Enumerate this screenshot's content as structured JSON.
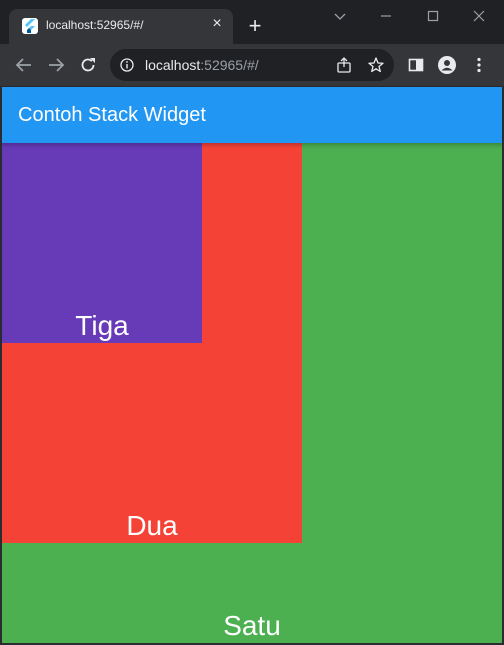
{
  "browser": {
    "tab": {
      "title": "localhost:52965/#/",
      "close_glyph": "×",
      "favicon": "flutter-logo-icon"
    },
    "new_tab_glyph": "+",
    "address": {
      "host": "localhost",
      "rest": ":52965/#/"
    },
    "icons": {
      "back": "back-arrow-icon",
      "forward": "forward-arrow-icon",
      "reload": "reload-icon",
      "info": "info-icon",
      "share": "share-icon",
      "star": "star-icon",
      "side_panel": "side-panel-icon",
      "profile": "profile-icon",
      "menu": "kebab-menu-icon",
      "tab_search": "chevron-down-icon",
      "minimize": "minimize-icon",
      "maximize": "maximize-icon",
      "close_window": "close-icon"
    }
  },
  "app": {
    "title": "Contoh Stack Widget",
    "colors": {
      "appbar": "#2196f3",
      "satu": "#4caf50",
      "dua": "#f44336",
      "tiga": "#673ab7",
      "text": "#ffffff"
    },
    "boxes": {
      "satu": "Satu",
      "dua": "Dua",
      "tiga": "Tiga"
    }
  }
}
